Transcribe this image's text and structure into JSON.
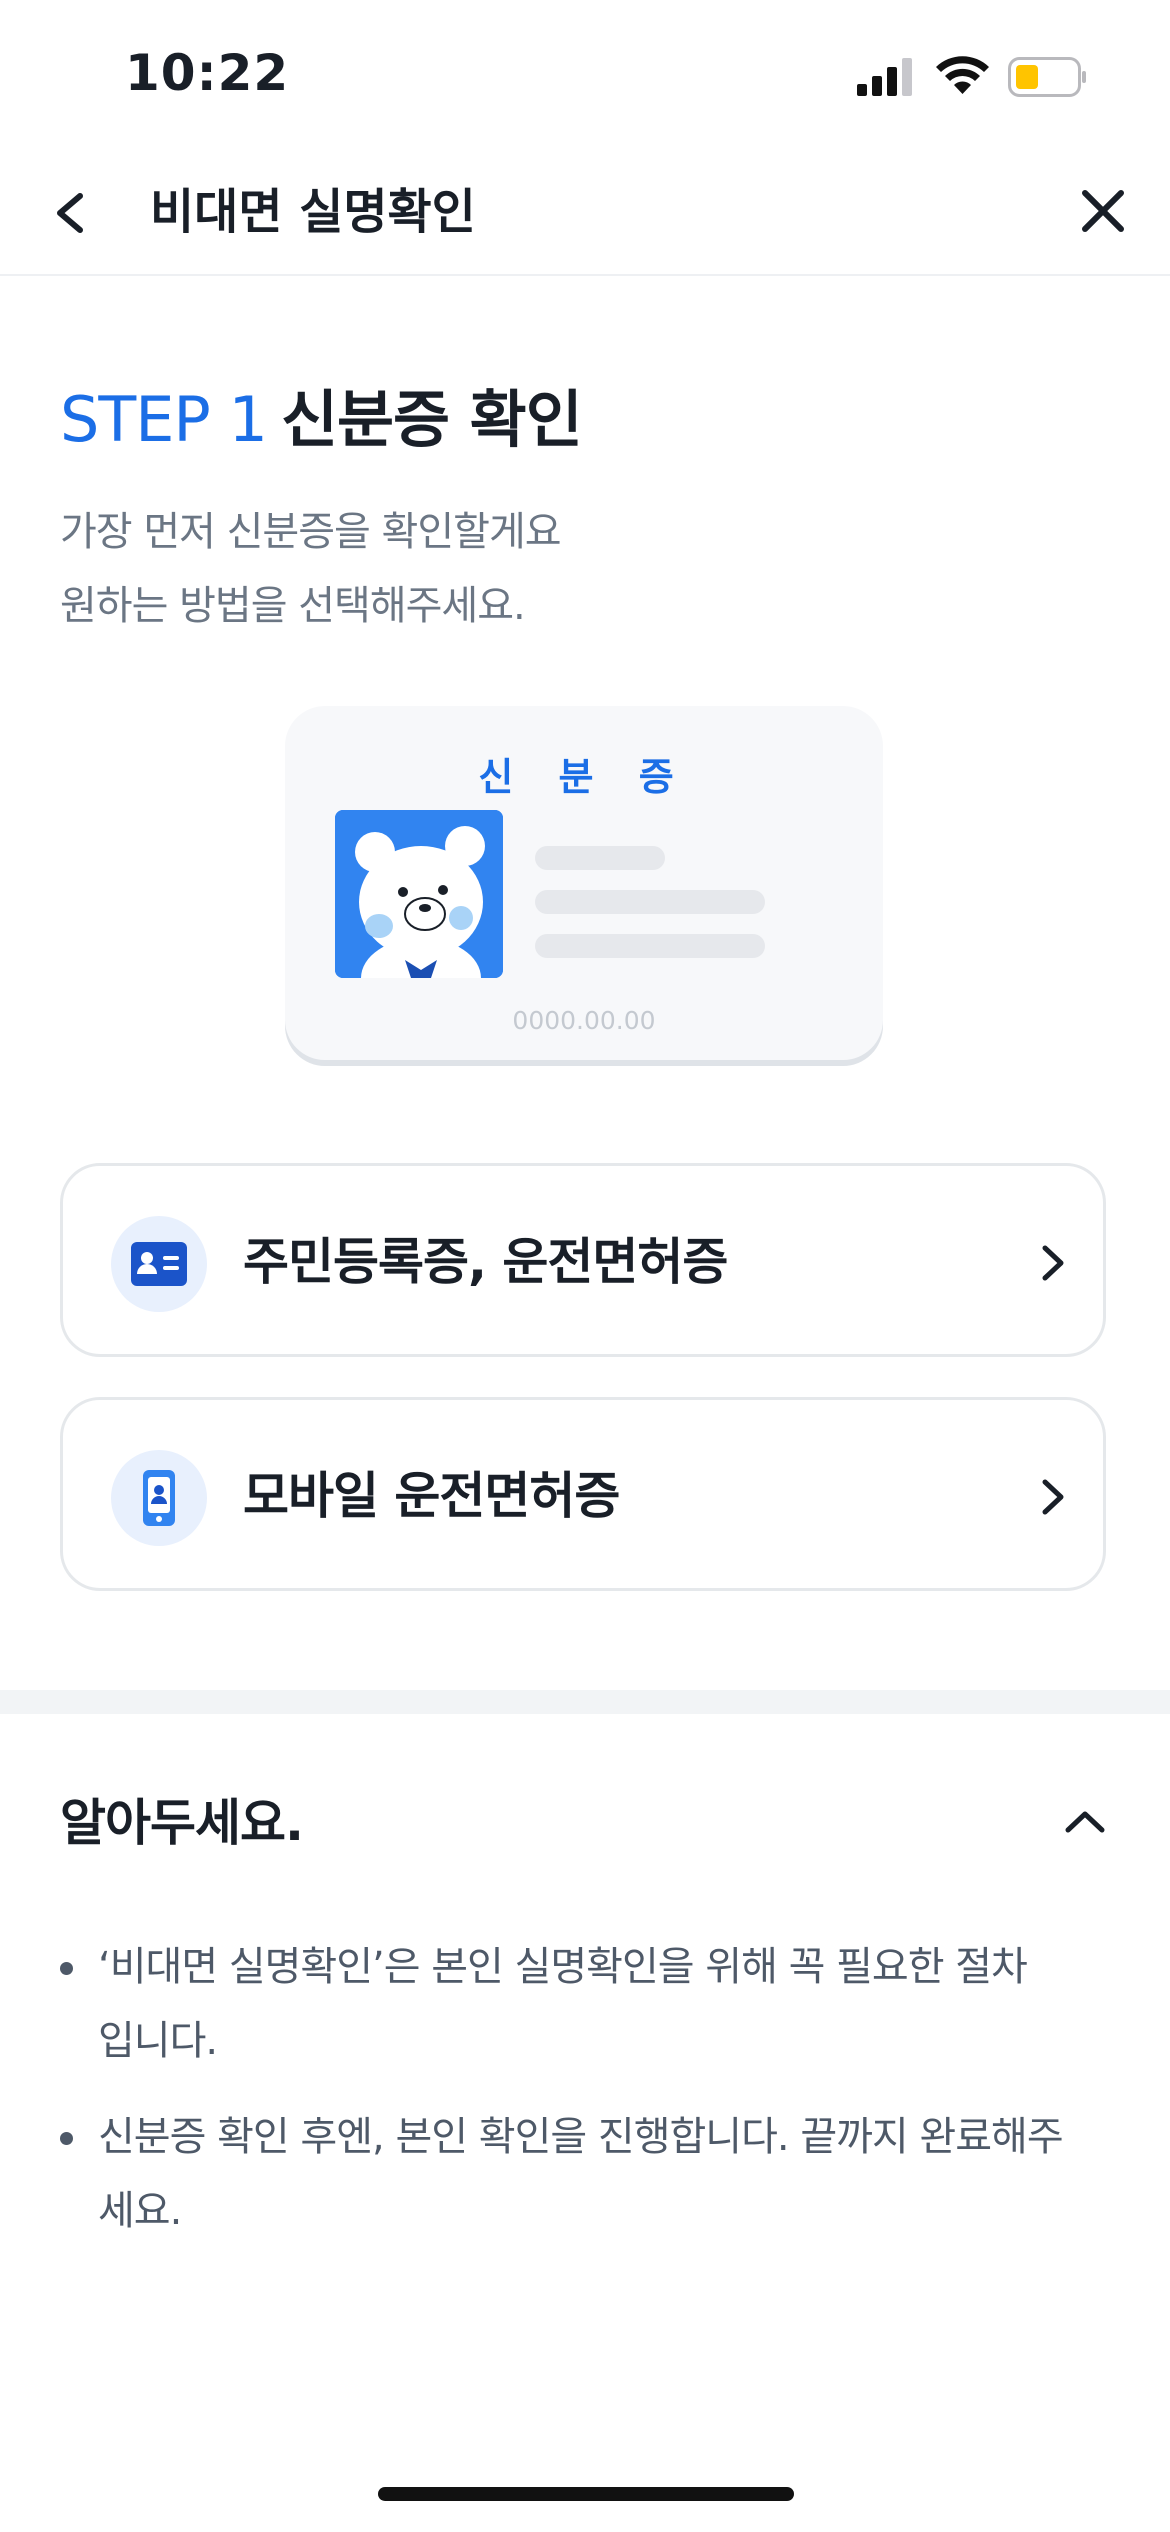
{
  "status_bar": {
    "time": "10:22",
    "battery_color": "#ffc400"
  },
  "nav": {
    "title": "비대면 실명확인"
  },
  "step": {
    "label": "STEP 1",
    "title": "신분증 확인",
    "description_line1": "가장 먼저 신분증을 확인할게요",
    "description_line2": "원하는 방법을 선택해주세요."
  },
  "id_card": {
    "title": "신 분 증",
    "date": "0000.00.00"
  },
  "options": [
    {
      "label": "주민등록증, 운전면허증",
      "icon": "id-card-icon"
    },
    {
      "label": "모바일 운전면허증",
      "icon": "mobile-license-icon"
    }
  ],
  "notice": {
    "title": "알아두세요.",
    "bullets": [
      {
        "line1": "‘비대면 실명확인’은 본인 실명확인을 위해 꼭 필요한 절차",
        "line2": "입니다."
      },
      {
        "line1": "신분증 확인 후엔, 본인 확인을 진행합니다. 끝까지 완료해주",
        "line2": "세요."
      }
    ]
  },
  "colors": {
    "accent": "#1b6ee6",
    "text": "#191f28",
    "subtext": "#6b7684"
  }
}
